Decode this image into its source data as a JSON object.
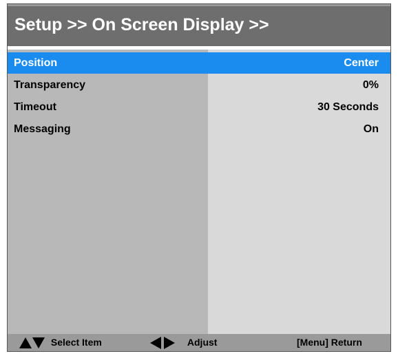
{
  "title": "Setup >> On Screen Display >>",
  "menu": [
    {
      "label": "Position",
      "value": "Center",
      "selected": true
    },
    {
      "label": "Transparency",
      "value": "0%",
      "selected": false
    },
    {
      "label": "Timeout",
      "value": "30 Seconds",
      "selected": false
    },
    {
      "label": "Messaging",
      "value": "On",
      "selected": false
    }
  ],
  "footer": {
    "select_label": "Select Item",
    "adjust_label": "Adjust",
    "return_label": "[Menu] Return"
  },
  "icons": [
    "up-arrow-icon",
    "down-arrow-icon",
    "left-arrow-icon",
    "right-arrow-icon"
  ],
  "colors": {
    "title_bar": "#6e6e6e",
    "selected_row": "#1a8cf0",
    "label_column": "#b8b8b8",
    "value_column": "#d9d9d9",
    "footer": "#9a9a9a"
  }
}
